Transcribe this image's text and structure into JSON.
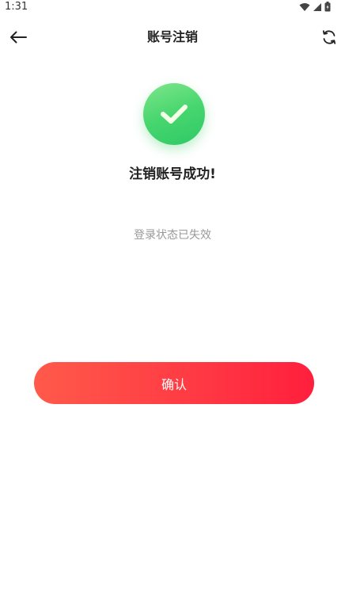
{
  "status_bar": {
    "time": "1:31"
  },
  "nav": {
    "title": "账号注销",
    "back_icon": "arrow-left-icon",
    "refresh_icon": "refresh-icon"
  },
  "result": {
    "icon": "check-circle-icon",
    "title": "注销账号成功!",
    "description": "登录状态已失效"
  },
  "actions": {
    "confirm_label": "确认"
  },
  "colors": {
    "success_green": "#3fd06b",
    "button_start": "#ff5a4a",
    "button_end": "#ff1f3d"
  }
}
